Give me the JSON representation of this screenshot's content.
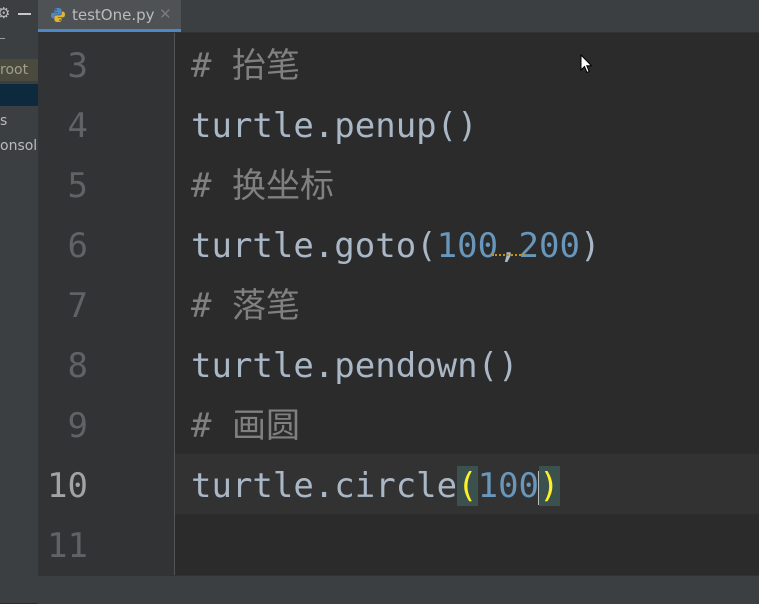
{
  "left_panel": {
    "rows": [
      {
        "label": "root"
      },
      {
        "label": ""
      },
      {
        "label": "s"
      },
      {
        "label": "onsol"
      }
    ]
  },
  "tabs": [
    {
      "label": "testOne.py",
      "icon": "python-file-icon",
      "active": true
    }
  ],
  "gutter": {
    "line_numbers": [
      "3",
      "4",
      "5",
      "6",
      "7",
      "8",
      "9",
      "10",
      "11"
    ],
    "current_line": "10"
  },
  "code": {
    "line3": {
      "hash": "# ",
      "text": "抬笔"
    },
    "line4": "turtle.penup()",
    "line5": {
      "hash": "# ",
      "text": "换坐标"
    },
    "line6": {
      "call": "turtle.goto(",
      "arg1": "100",
      "sep": ",",
      "arg2": "200",
      "close": ")"
    },
    "line7": {
      "hash": "# ",
      "text": "落笔"
    },
    "line8": "turtle.pendown()",
    "line9": {
      "hash": "# ",
      "text": "画圆"
    },
    "line10": {
      "call": "turtle.circle",
      "open": "(",
      "arg": "100",
      "close": ")"
    },
    "line11": ""
  },
  "colors": {
    "editor_bg": "#2b2b2b",
    "comment": "#808080",
    "identifier": "#a9b7c6",
    "number": "#6897bb",
    "brace_match": "#ffef28",
    "tab_underline": "#4a88c7"
  }
}
